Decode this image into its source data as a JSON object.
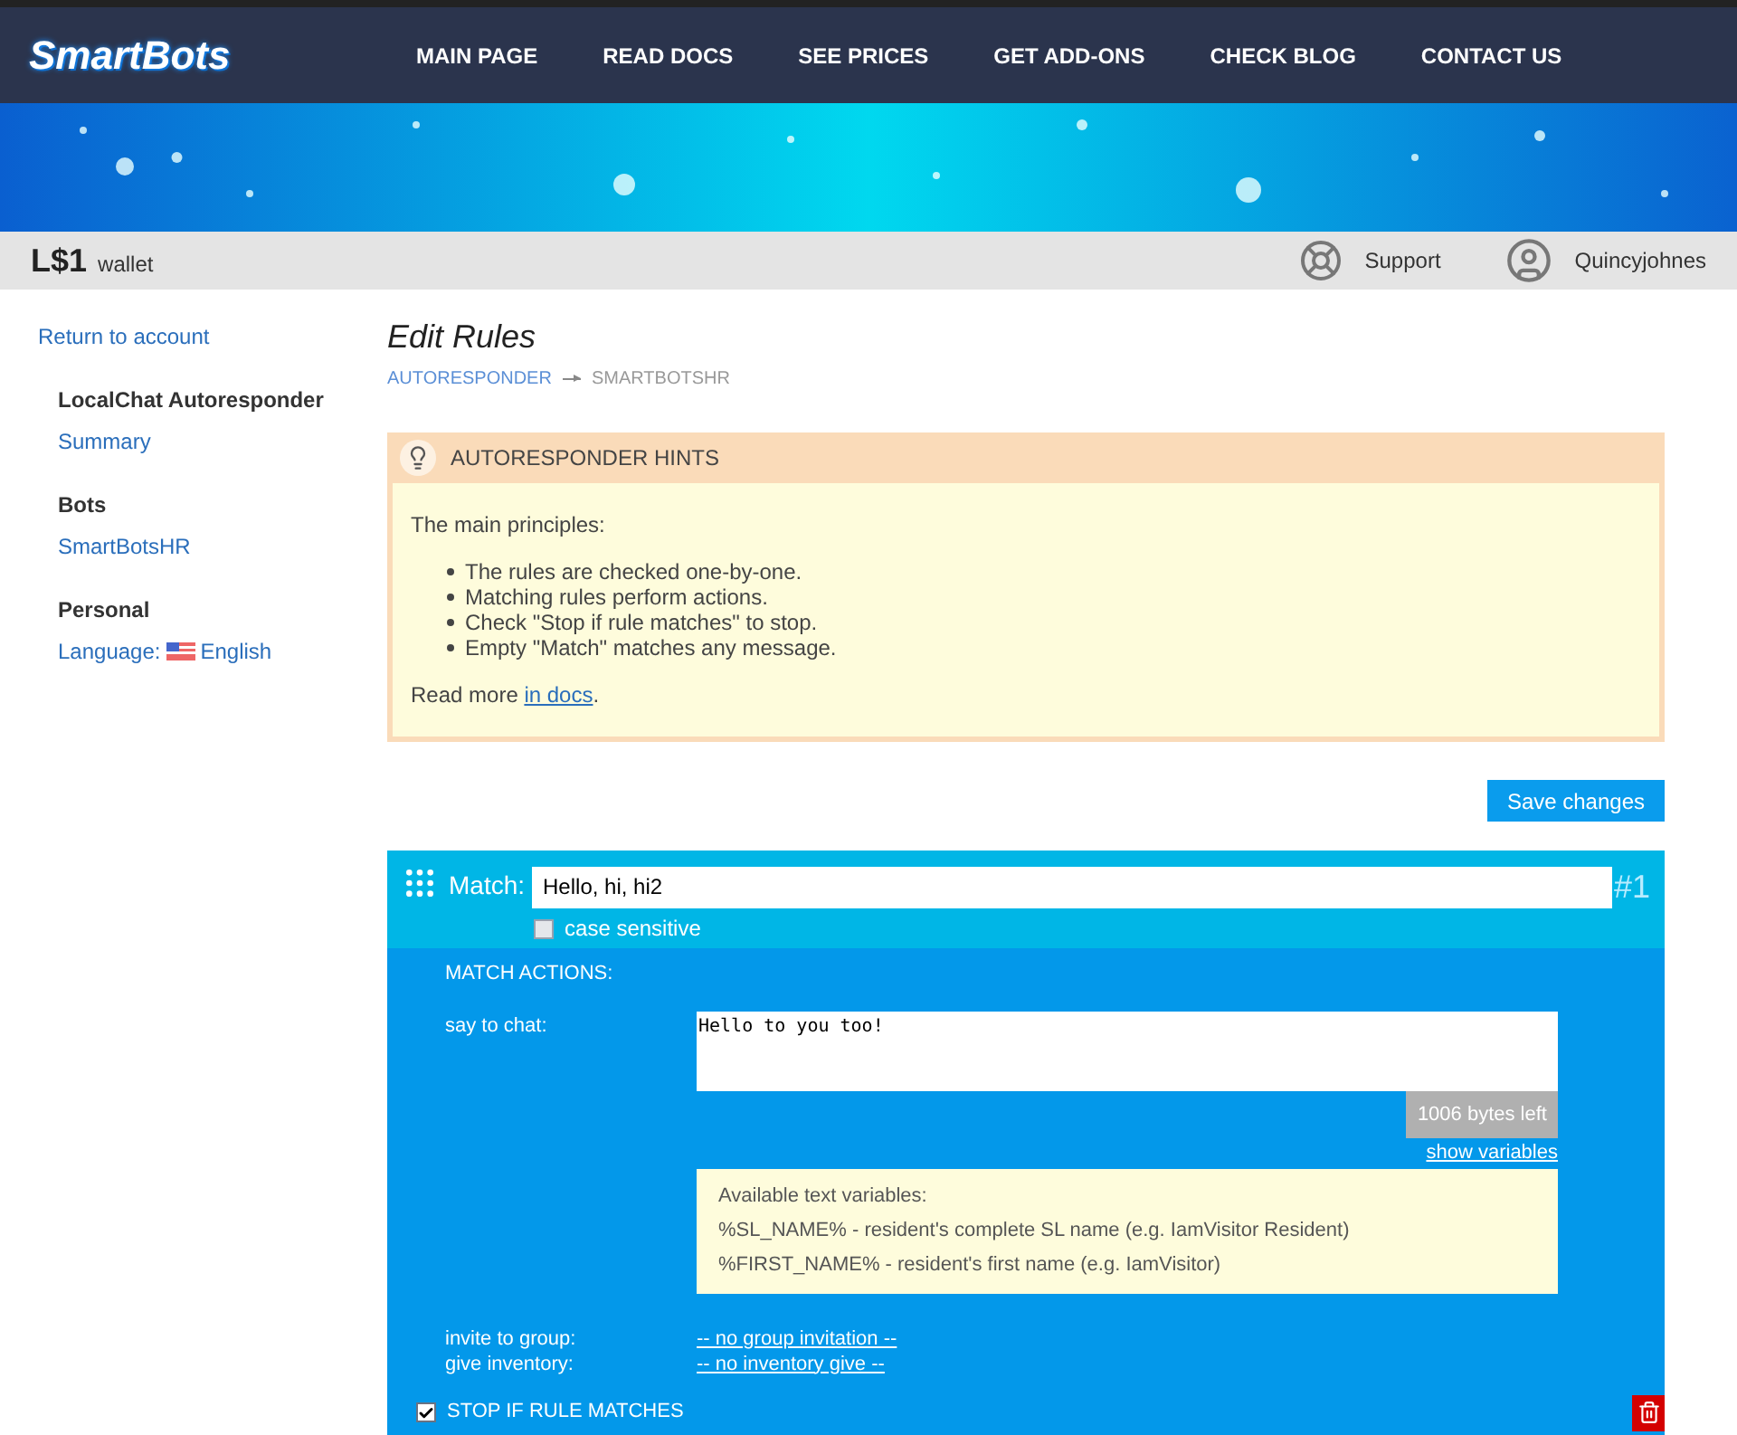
{
  "logo": "SmartBots",
  "nav": [
    {
      "label": "MAIN PAGE"
    },
    {
      "label": "READ DOCS"
    },
    {
      "label": "SEE PRICES"
    },
    {
      "label": "GET ADD-ONS"
    },
    {
      "label": "CHECK BLOG"
    },
    {
      "label": "CONTACT US"
    }
  ],
  "account_bar": {
    "balance": "L$1",
    "balance_label": "wallet",
    "support": "Support",
    "user": "Quincyjohnes"
  },
  "sidebar": {
    "back_link": "Return to account",
    "sections": [
      {
        "title": "LocalChat Autoresponder",
        "items": [
          {
            "label": "Summary",
            "kind": "link"
          }
        ]
      },
      {
        "title": "Bots",
        "items": [
          {
            "label": "SmartBotsHR",
            "kind": "link"
          }
        ]
      },
      {
        "title": "Personal",
        "items": [
          {
            "label": "Language:",
            "value": "English",
            "kind": "language"
          }
        ]
      }
    ]
  },
  "page": {
    "title": "Edit Rules",
    "breadcrumb": [
      {
        "label": "AUTORESPONDER",
        "link": true
      },
      {
        "label": "SMARTBOTSHR",
        "link": false
      }
    ]
  },
  "hints": {
    "title": "AUTORESPONDER HINTS",
    "intro": "The main principles:",
    "bullets": [
      "The rules are checked one-by-one.",
      "Matching rules perform actions.",
      "Check \"Stop if rule matches\" to stop.",
      "Empty \"Match\" matches any message."
    ],
    "read_more": "Read more ",
    "read_more_link": "in docs",
    "read_more_end": "."
  },
  "save_button": "Save changes",
  "rule": {
    "match_label": "Match:",
    "match_value": "Hello, hi, hi2",
    "number": "#1",
    "case_sensitive": {
      "label": "case sensitive",
      "checked": false
    },
    "actions_title": "MATCH ACTIONS:",
    "say_label": "say to chat:",
    "say_value": "Hello to you too!",
    "bytes_left": "1006 bytes left",
    "show_variables": "show variables",
    "variables": [
      "Available text variables:",
      "%SL_NAME% - resident's complete SL name (e.g. IamVisitor Resident)",
      "%FIRST_NAME% - resident's first name (e.g. IamVisitor)"
    ],
    "invite_label": "invite to group:",
    "invite_value": "-- no group invitation --",
    "inventory_label": "give inventory:",
    "inventory_value": "-- no inventory give --",
    "stop": {
      "label": "STOP IF RULE MATCHES",
      "checked": true
    }
  }
}
